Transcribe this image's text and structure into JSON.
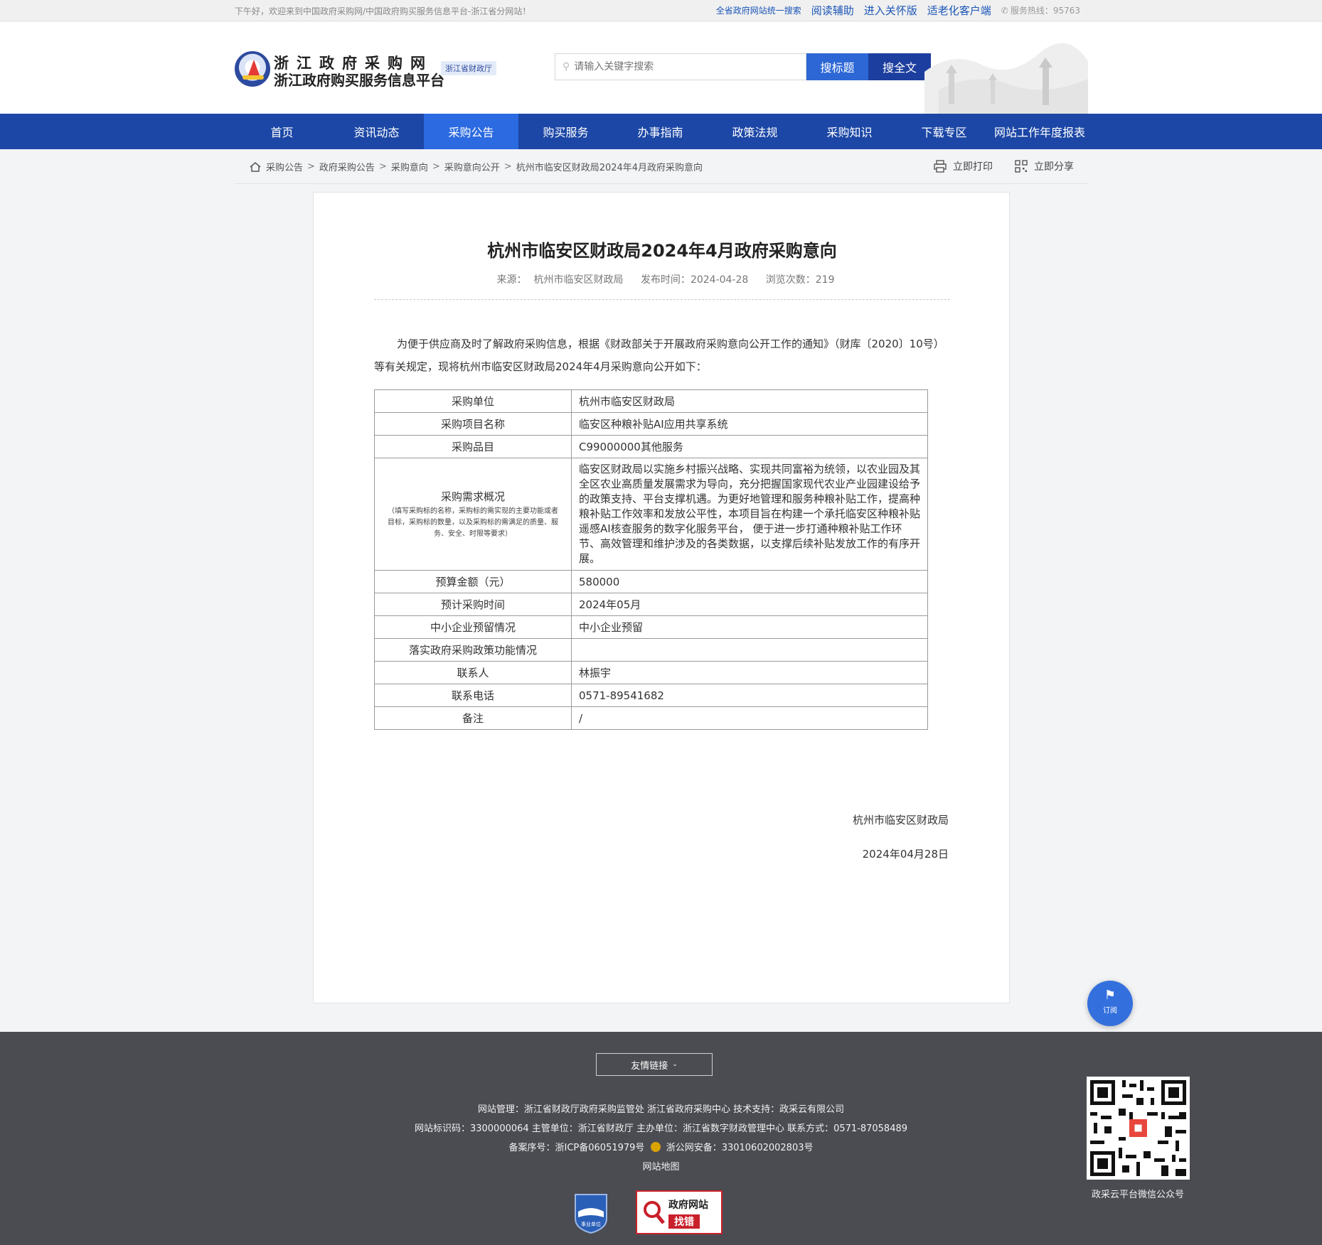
{
  "topbar": {
    "welcome": "下午好，欢迎来到中国政府采购网/中国政府购买服务信息平台-浙江省分网站！",
    "search_all_sites": "全省政府网站统一搜索",
    "reading_aid": "阅读辅助",
    "care_mode": "进入关怀版",
    "elderly_client": "适老化客户端",
    "hotline": "服务热线：95763"
  },
  "header": {
    "title_line1": "浙江政府采购网",
    "title_line2": "浙江政府购买服务信息平台",
    "badge": "浙江省财政厅",
    "search_placeholder": "请输入关键字搜索",
    "search_title_btn": "搜标题",
    "search_full_btn": "搜全文"
  },
  "nav": {
    "items": [
      "首页",
      "资讯动态",
      "采购公告",
      "购买服务",
      "办事指南",
      "政策法规",
      "采购知识",
      "下载专区",
      "网站工作年度报表"
    ],
    "active_index": 2
  },
  "breadcrumb": {
    "items": [
      "采购公告",
      "政府采购公告",
      "采购意向",
      "采购意向公开",
      "杭州市临安区财政局2024年4月政府采购意向"
    ],
    "separator": ">",
    "print": "立即打印",
    "share": "立即分享"
  },
  "article": {
    "title": "杭州市临安区财政局2024年4月政府采购意向",
    "source_label": "来源：",
    "source": "杭州市临安区财政局",
    "date_label": "发布时间：",
    "date": "2024-04-28",
    "views_label": "浏览次数：",
    "views": "219",
    "intro": "为便于供应商及时了解政府采购信息，根据《财政部关于开展政府采购意向公开工作的通知》（财库〔2020〕10号）等有关规定，现将杭州市临安区财政局2024年4月采购意向公开如下：",
    "table": {
      "purchaser_label": "采购单位",
      "purchaser": "杭州市临安区财政局",
      "project_label": "采购项目名称",
      "project": "临安区种粮补贴AI应用共享系统",
      "category_label": "采购品目",
      "category": "C99000000其他服务",
      "demand_label": "采购需求概况",
      "demand_note": "（填写采购标的名称，采购标的需实现的主要功能或者目标，采购标的数量，以及采购标的需满足的质量、服务、安全、时限等要求）",
      "demand": "临安区财政局以实施乡村振兴战略、实现共同富裕为统领，以农业园及其全区农业高质量发展需求为导向，充分把握国家现代农业产业园建设给予的政策支持、平台支撑机遇。为更好地管理和服务种粮补贴工作，提高种粮补贴工作效率和发放公平性，本项目旨在构建一个承托临安区种粮补贴遥感AI核查服务的数字化服务平台， 便于进一步打通种粮补贴工作环节、高效管理和维护涉及的各类数据，以支撑后续补贴发放工作的有序开展。",
      "budget_label": "预算金额（元）",
      "budget": "580000",
      "time_label": "预计采购时间",
      "time": "2024年05月",
      "sme_label": "中小企业预留情况",
      "sme": "中小企业预留",
      "policy_label": "落实政府采购政策功能情况",
      "policy": "",
      "contact_label": "联系人",
      "contact": "林振宇",
      "phone_label": "联系电话",
      "phone": "0571-89541682",
      "remark_label": "备注",
      "remark": "/"
    },
    "sign_org": "杭州市临安区财政局",
    "sign_date": "2024年04月28日"
  },
  "subscribe": {
    "label": "订阅"
  },
  "footer": {
    "friend_links": "友情链接",
    "line1": "网站管理：浙江省财政厅政府采购监管处 浙江省政府采购中心 技术支持：政采云有限公司",
    "line2": "网站标识码：3300000064 主管单位：浙江省财政厅 主办单位：浙江省数字财政管理中心 联系方式：0571-87058489",
    "icp": "备案序号：浙ICP备06051979号",
    "police": "浙公网安备：33010602002803号",
    "sitemap": "网站地图",
    "badge_institution": "事业单位",
    "badge_gov_line1": "政府网站",
    "badge_gov_line2": "找错",
    "qr_label": "政采云平台微信公众号"
  }
}
